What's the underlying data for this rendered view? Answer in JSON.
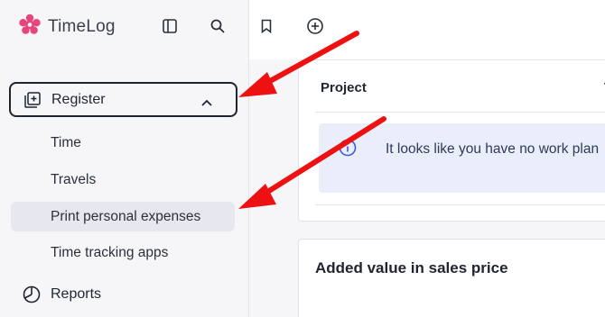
{
  "app": {
    "name": "TimeLog",
    "brand_color": "#e8457c"
  },
  "topbar": {
    "icons": [
      "sidebar-toggle-icon",
      "search-icon",
      "bookmark-icon",
      "plus-circle-icon"
    ]
  },
  "sidebar": {
    "register": {
      "label": "Register",
      "expanded": true
    },
    "sub_items": [
      {
        "label": "Time"
      },
      {
        "label": "Travels"
      },
      {
        "label": "Print personal expenses",
        "active": true
      },
      {
        "label": "Time tracking apps"
      }
    ],
    "reports": {
      "label": "Reports"
    }
  },
  "main": {
    "card1": {
      "header_project": "Project",
      "header_more": "T",
      "alert_text": "It looks like you have no work plan",
      "alert_color": "#eaedfa"
    },
    "card2": {
      "title": "Added value in sales price"
    }
  },
  "annotations": {
    "arrow_color": "#ee1111"
  }
}
